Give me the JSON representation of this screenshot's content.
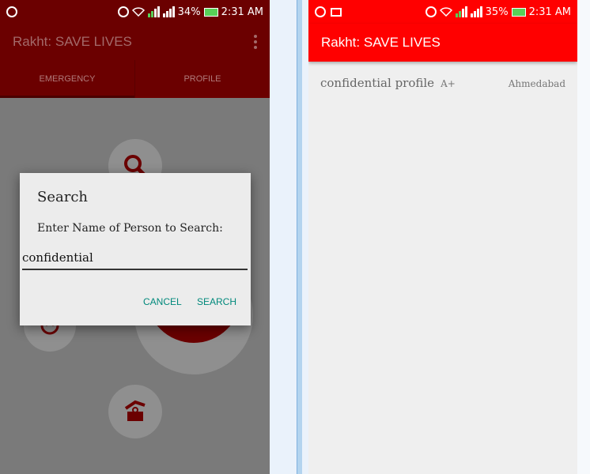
{
  "left_screen": {
    "status_bar": {
      "battery_percent": "34%",
      "time": "2:31 AM",
      "icons": [
        "messenger-icon",
        "alarm-icon",
        "wifi-icon",
        "signal-icon",
        "battery-charging-icon"
      ]
    },
    "app_bar": {
      "title": "Rakht: SAVE LIVES",
      "menu_icon": "overflow-menu-icon"
    },
    "tabs": [
      {
        "label": "EMERGENCY",
        "active": true
      },
      {
        "label": "PROFILE",
        "active": false
      }
    ],
    "home_buttons": [
      {
        "icon": "search-icon"
      },
      {
        "icon": "blood-drop-icon"
      },
      {
        "icon": "help-icon"
      },
      {
        "icon": "donate-icon"
      }
    ],
    "dialog": {
      "title": "Search",
      "message": "Enter Name of Person to Search:",
      "input_value": "confidential",
      "cancel_label": "CANCEL",
      "search_label": "SEARCH"
    }
  },
  "right_screen": {
    "status_bar": {
      "battery_percent": "35%",
      "time": "2:31 AM",
      "icons": [
        "messenger-icon",
        "gallery-icon",
        "alarm-icon",
        "wifi-icon",
        "signal-icon",
        "battery-charging-icon"
      ]
    },
    "app_bar": {
      "title": "Rakht: SAVE LIVES"
    },
    "results": [
      {
        "name": "confidential profile",
        "blood_group": "A+",
        "city": "Ahmedabad"
      }
    ]
  },
  "colors": {
    "primary_red": "#ff0000",
    "dimmed_red": "#6b0000",
    "accent_teal": "#00897b"
  }
}
